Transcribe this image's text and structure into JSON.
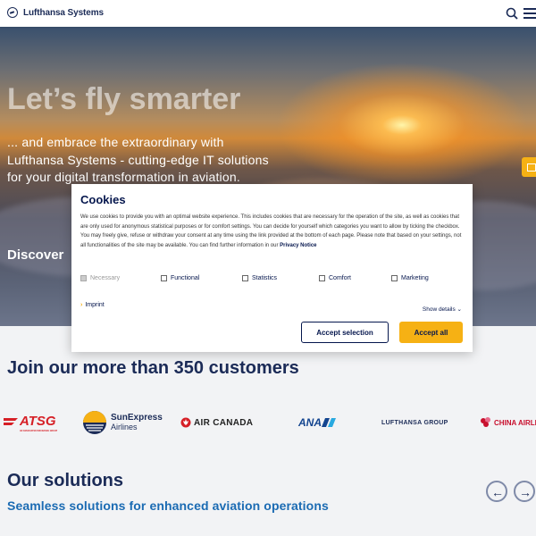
{
  "header": {
    "brand": "Lufthansa Systems",
    "icons": {
      "logo": "crane-logo-icon",
      "search": "search-icon",
      "menu": "hamburger-menu-icon"
    }
  },
  "hero": {
    "title": "Let’s fly smarter",
    "text": "... and embrace the extraordinary with Lufthansa Systems - cutting-edge IT solutions for your digital transformation in aviation.",
    "cta": "Discover"
  },
  "customers": {
    "title": "Join our more than 350 customers",
    "logos": [
      {
        "main": "ATSG",
        "sub": "AN ASSOCIATED INSURANCE GROUP",
        "color": "#d61f26"
      },
      {
        "main": "SunExpress",
        "sub": "Airlines",
        "color": "#1b2b57"
      },
      {
        "main": "AIR CANADA",
        "color": "#d61f26"
      },
      {
        "main": "ANA",
        "color": "#13448f"
      },
      {
        "main": "LUFTHANSA GROUP",
        "color": "#1b2b57"
      },
      {
        "main": "CHINA AIRLINES",
        "color": "#c8102e"
      }
    ]
  },
  "solutions": {
    "title": "Our solutions",
    "subtitle": "Seamless solutions for enhanced aviation operations",
    "prev_icon": "arrow-left-icon",
    "next_icon": "arrow-right-icon",
    "prev_glyph": "←",
    "next_glyph": "→"
  },
  "cookies": {
    "title": "Cookies",
    "text": "We use cookies to provide you with an optimal website experience. This includes cookies that are necessary for the operation of the site, as well as cookies that are only used for anonymous statistical purposes or for comfort settings. You can decide for yourself which categories you want to allow by ticking the checkbox. You may freely give, refuse or withdraw your consent at any time using the link provided at the bottom of each page. Please note that based on your settings, not all functionalities of the site may be available. You can find further information in our",
    "privacy_link": "Privacy Notice",
    "categories": [
      {
        "label": "Necessary",
        "checked": true,
        "disabled": true
      },
      {
        "label": "Functional",
        "checked": false
      },
      {
        "label": "Statistics",
        "checked": false
      },
      {
        "label": "Comfort",
        "checked": false
      },
      {
        "label": "Marketing",
        "checked": false
      }
    ],
    "imprint": "Imprint",
    "show_details": "Show details",
    "accept_selection": "Accept selection",
    "accept_all": "Accept all",
    "colors": {
      "accent": "#f6b114",
      "navy": "#05164d"
    }
  }
}
